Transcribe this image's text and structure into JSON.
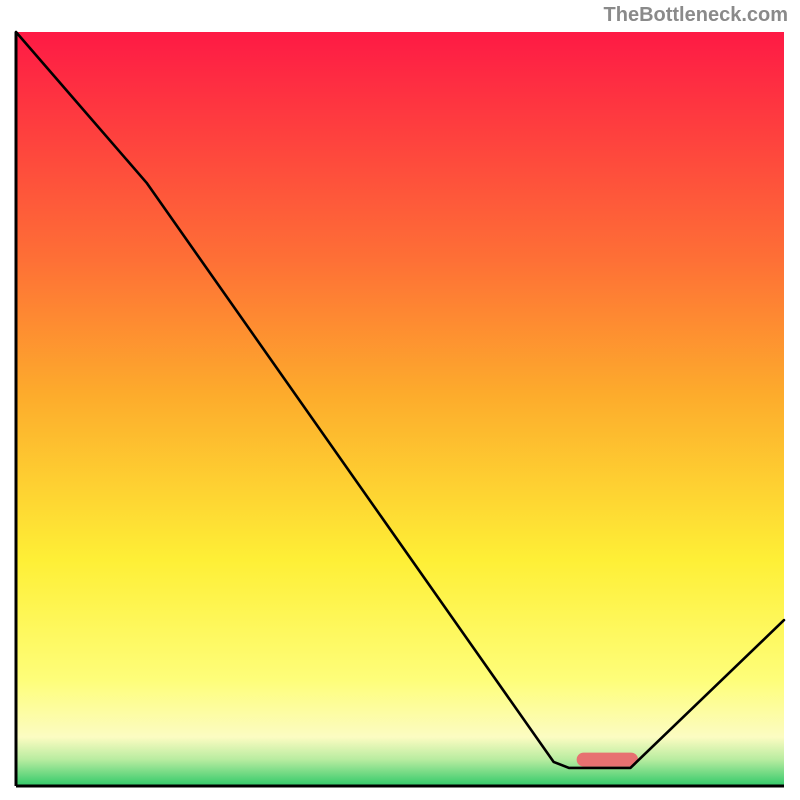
{
  "attribution": "TheBottleneck.com",
  "chart_data": {
    "type": "line",
    "title": "",
    "xlabel": "",
    "ylabel": "",
    "xlim": [
      0,
      100
    ],
    "ylim": [
      0,
      100
    ],
    "legend": false,
    "grid": false,
    "background_gradient": {
      "top": "#fe1a45",
      "mid_upper": "#fdab2c",
      "mid": "#feef36",
      "lower": "#fcfcc2",
      "bottom": "#31c969"
    },
    "curve": {
      "description": "black curve descending from top-left, kinking near x≈17, continuing down to a flat minimum near x≈72-80 touching the green floor, then rising to the right edge",
      "points_xy": [
        [
          0,
          100
        ],
        [
          17,
          80
        ],
        [
          70,
          3.2
        ],
        [
          72,
          2.4
        ],
        [
          80,
          2.4
        ],
        [
          100,
          22
        ]
      ]
    },
    "marker": {
      "description": "short horizontal salmon capsule at the curve minimum",
      "x_range": [
        73,
        81
      ],
      "y": 3.5,
      "color": "#e77171"
    }
  }
}
